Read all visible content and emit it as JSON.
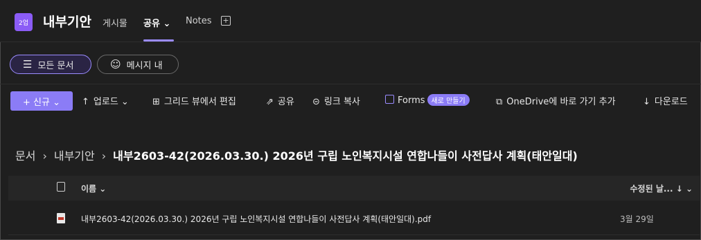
{
  "header": {
    "badge": "2업",
    "title": "내부기안",
    "tabs": [
      {
        "label": "게시물"
      },
      {
        "label": "공유 ⌄"
      },
      {
        "label": "Notes"
      }
    ],
    "add_tab": "+"
  },
  "views": {
    "all_docs": "모든 문서",
    "in_message": "메시지 내"
  },
  "toolbar": {
    "new": "+ 신규 ⌄",
    "upload": "업로드 ⌄",
    "grid_edit": "그리드 뷰에서 편집",
    "share": "공유",
    "copy_link": "링크 복사",
    "forms": "Forms",
    "forms_badge": "새로 만들기",
    "onedrive": "OneDrive에 바로 가기 추가",
    "download": "다운로드"
  },
  "breadcrumb": {
    "root": "문서",
    "parent": "내부기안",
    "current": "내부2603-42(2026.03.30.) 2026년 구립 노인복지시설 연합나들이 사전답사 계획(태안일대)"
  },
  "table": {
    "col_name": "이름 ⌄",
    "col_modified": "수정된 날... ↓ ⌄",
    "rows": [
      {
        "name": "내부2603-42(2026.03.30.) 2026년 구립 노인복지시설 연합나들이 사전답사 계획(태안일대).pdf",
        "modified": "3월 29일"
      }
    ]
  },
  "colors": {
    "accent": "#8b7cf6",
    "background": "#1f1f1f"
  }
}
